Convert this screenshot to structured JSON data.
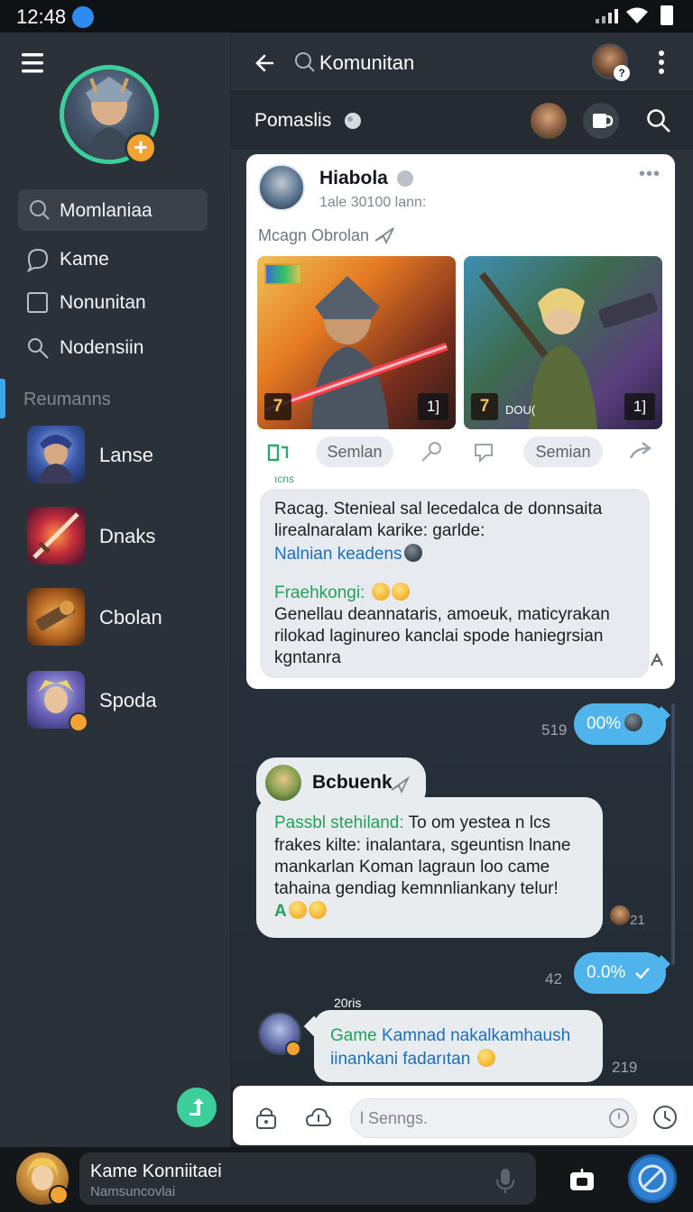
{
  "status": {
    "time": "12:48"
  },
  "sidebar": {
    "search_label": "Momlaniaa",
    "nav": [
      {
        "label": "Kame",
        "icon": "chat-bubble-icon"
      },
      {
        "label": "Nonunitan",
        "icon": "square-icon"
      },
      {
        "label": "Nodensiin",
        "icon": "search-icon"
      }
    ],
    "section_label": "Reumanns",
    "rooms": [
      {
        "label": "Lanse"
      },
      {
        "label": "Dnaks"
      },
      {
        "label": "Cbolan"
      },
      {
        "label": "Spoda"
      }
    ]
  },
  "header": {
    "title": "Komunitan",
    "subtitle": "Pomaslis"
  },
  "post": {
    "author": "Hiabola",
    "time": "1ale 30100 lann:",
    "subtitle": "Mcagn Obrolan",
    "images": [
      {
        "badge_left": "7",
        "badge_right": "1]"
      },
      {
        "badge_left": "7",
        "badge_right": "1]",
        "tag": "DOU("
      }
    ],
    "actions": {
      "pill1": "Semlan",
      "pill2": "Semian"
    },
    "small_label": "ıcns",
    "quote": {
      "line1": "Racag. Stenieal sal lecedalca de donnsaita",
      "line2": "lirealnaralam karike: garlde:",
      "link": "Nalnian keadens",
      "green": "Fraehkongi:",
      "line4": "Genellau deannataris, amoeuk, maticyrakan",
      "line5": "rilokad laginureo kanclai spode haniegrsian",
      "line6": "kgntanra"
    }
  },
  "messages": {
    "out1": {
      "time": "519",
      "text": "00%"
    },
    "in1": {
      "name": "Bcbuenk",
      "green": "Passbl stehiland:",
      "line1": "To om yestea n lcs",
      "line2": "frakes kilte: inalantara, sgeuntisn lnane",
      "line3": "mankarlan Koman lagraun loo came",
      "line4": "tahaina gendiag kemnnliankany telur!",
      "prefix": "A",
      "time": "21"
    },
    "out2": {
      "time": "42",
      "text": "0.0%"
    },
    "in2": {
      "label": "20ris",
      "green": "Game",
      "blue": "Kamnad nakalkamhaush",
      "line2": "iinankani fadarıtan",
      "time": "219"
    }
  },
  "composer": {
    "placeholder": "l Senngs."
  },
  "me": {
    "name": "Kame Konniitaei",
    "status": "Namsuncovlai"
  }
}
